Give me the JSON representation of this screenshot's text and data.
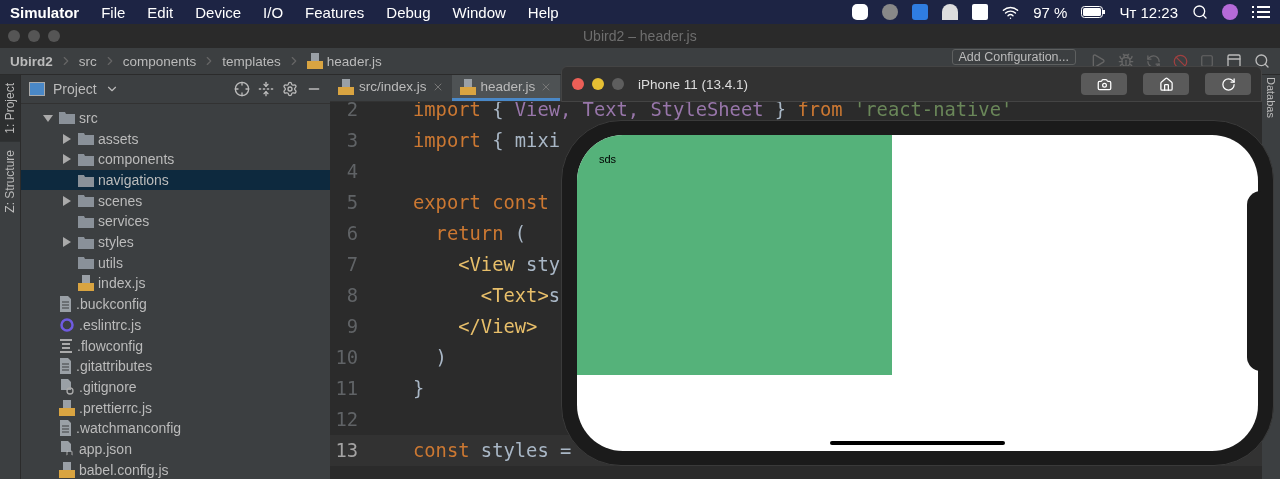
{
  "menu_bar": {
    "app": "Simulator",
    "items": [
      "File",
      "Edit",
      "Device",
      "I/O",
      "Features",
      "Debug",
      "Window",
      "Help"
    ],
    "battery": "97 %",
    "clock": "Чт 12:23"
  },
  "ide": {
    "title": "Ubird2 – header.js",
    "breadcrumbs": [
      {
        "label": "Ubird2",
        "kind": "project"
      },
      {
        "label": "src",
        "kind": "folder"
      },
      {
        "label": "components",
        "kind": "folder"
      },
      {
        "label": "templates",
        "kind": "folder"
      },
      {
        "label": "header.js",
        "kind": "js"
      }
    ],
    "run_config": "Add Configuration...",
    "side_tabs": [
      {
        "label": "1: Project",
        "selected": true
      },
      {
        "label": "Z: Structure",
        "selected": false
      }
    ],
    "right_tab": "Databas",
    "project_panel": {
      "title": "Project",
      "tree": [
        {
          "label": "src",
          "kind": "folder",
          "expanded": true,
          "selected": false,
          "children": [
            {
              "label": "assets",
              "kind": "folder",
              "expanded": false,
              "selected": false
            },
            {
              "label": "components",
              "kind": "folder",
              "expanded": false,
              "selected": false
            },
            {
              "label": "navigations",
              "kind": "folder",
              "selected": true
            },
            {
              "label": "scenes",
              "kind": "folder",
              "expanded": false,
              "selected": false
            },
            {
              "label": "services",
              "kind": "folder",
              "selected": false
            },
            {
              "label": "styles",
              "kind": "folder",
              "expanded": false,
              "selected": false
            },
            {
              "label": "utils",
              "kind": "folder",
              "selected": false
            },
            {
              "label": "index.js",
              "kind": "js",
              "selected": false
            }
          ]
        },
        {
          "label": ".buckconfig",
          "kind": "config",
          "selected": false
        },
        {
          "label": ".eslintrc.js",
          "kind": "eslint",
          "selected": false
        },
        {
          "label": ".flowconfig",
          "kind": "flow",
          "selected": false
        },
        {
          "label": ".gitattributes",
          "kind": "config",
          "selected": false
        },
        {
          "label": ".gitignore",
          "kind": "gitignore",
          "selected": false
        },
        {
          "label": ".prettierrc.js",
          "kind": "js",
          "selected": false
        },
        {
          "label": ".watchmanconfig",
          "kind": "config",
          "selected": false
        },
        {
          "label": "app.json",
          "kind": "json",
          "selected": false
        },
        {
          "label": "babel.config.js",
          "kind": "js",
          "selected": false
        }
      ]
    },
    "editor": {
      "tabs": [
        {
          "label": "src/index.js",
          "selected": false
        },
        {
          "label": "header.js",
          "selected": true
        }
      ],
      "lines": [
        {
          "number": "2",
          "current": false,
          "tokens": [
            {
              "kind": "keyword",
              "text": "import"
            },
            {
              "kind": "plain",
              "text": " { "
            },
            {
              "kind": "ident",
              "text": "View, Text, StyleSheet"
            },
            {
              "kind": "plain",
              "text": " } "
            },
            {
              "kind": "keyword",
              "text": "from"
            },
            {
              "kind": "string",
              "text": " 'react-native'"
            }
          ]
        },
        {
          "number": "3",
          "current": false,
          "tokens": [
            {
              "kind": "keyword",
              "text": "import"
            },
            {
              "kind": "plain",
              "text": " { mixi"
            }
          ]
        },
        {
          "number": "4",
          "current": false
        },
        {
          "number": "5",
          "current": false,
          "tokens": [
            {
              "kind": "keyword",
              "text": "export const"
            }
          ]
        },
        {
          "number": "6",
          "current": false,
          "tokens": [
            {
              "kind": "keyword",
              "text": "  return"
            },
            {
              "kind": "plain",
              "text": " ("
            }
          ]
        },
        {
          "number": "7",
          "current": false,
          "tokens": [
            {
              "kind": "tag",
              "text": "    <View"
            },
            {
              "kind": "plain",
              "text": " sty"
            }
          ]
        },
        {
          "number": "8",
          "current": false,
          "tokens": [
            {
              "kind": "tag",
              "text": "      <Text>"
            },
            {
              "kind": "plain",
              "text": "s"
            }
          ]
        },
        {
          "number": "9",
          "current": false,
          "tokens": [
            {
              "kind": "tag",
              "text": "    </View>"
            }
          ]
        },
        {
          "number": "10",
          "current": false,
          "tokens": [
            {
              "kind": "plain",
              "text": "  )"
            }
          ]
        },
        {
          "number": "11",
          "current": false,
          "tokens": [
            {
              "kind": "plain",
              "text": "}"
            }
          ]
        },
        {
          "number": "12",
          "current": false
        },
        {
          "number": "13",
          "current": true,
          "tokens": [
            {
              "kind": "keyword",
              "text": "const"
            },
            {
              "kind": "plain",
              "text": " styles ="
            }
          ]
        }
      ]
    }
  },
  "simulator": {
    "title": "iPhone 11 (13.4.1)",
    "screen_text": "sds"
  }
}
